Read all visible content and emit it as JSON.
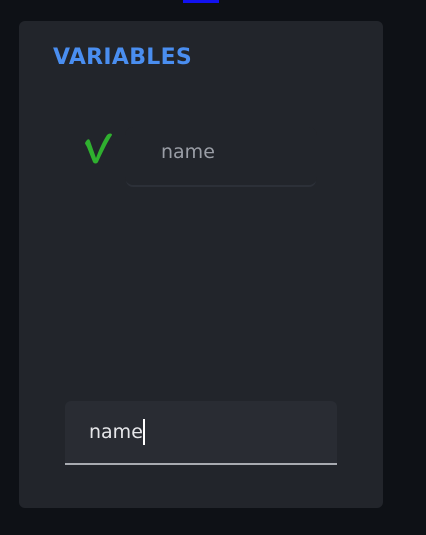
{
  "panel": {
    "title": "VARIABLES"
  },
  "variables": [
    {
      "icon": "green-v-icon",
      "name": "name"
    }
  ],
  "new_variable_input": {
    "value": "name",
    "focused": true
  },
  "colors": {
    "accent": "#4a8ef0",
    "variable_icon": "#2fb02f",
    "panel_bg": "#22252b",
    "page_bg": "#0e1116",
    "top_indicator": "#1212f0"
  }
}
